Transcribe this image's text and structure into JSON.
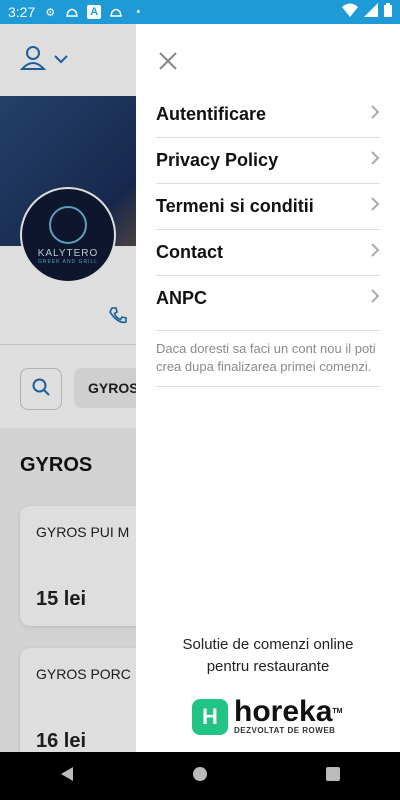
{
  "status_bar": {
    "time": "3:27",
    "icons_left": [
      "settings-icon",
      "notification-icon",
      "a-icon",
      "notification-icon",
      "dot-icon"
    ],
    "icons_right": [
      "wifi-icon",
      "signal-icon",
      "battery-icon"
    ]
  },
  "background": {
    "restaurant_logo_name": "KALYTERO",
    "restaurant_logo_sub": "GREEK AND GRILL",
    "category_chip": "GYROS",
    "section_title": "GYROS",
    "products": [
      {
        "name": "GYROS PUI M",
        "price": "15 lei"
      },
      {
        "name": "GYROS PORC",
        "price": "16 lei"
      }
    ]
  },
  "drawer": {
    "menu": [
      {
        "label": "Autentificare"
      },
      {
        "label": "Privacy Policy"
      },
      {
        "label": "Termeni si conditii"
      },
      {
        "label": "Contact"
      },
      {
        "label": "ANPC"
      }
    ],
    "note": "Daca doresti sa faci un cont nou il poti crea dupa finalizarea primei comenzi.",
    "footer_line1": "Solutie de comenzi online",
    "footer_line2": "pentru restaurante",
    "brand_name": "horeka",
    "brand_tm": "TM",
    "brand_sub": "DEZVOLTAT DE ROWEB"
  },
  "colors": {
    "status_bar": "#1e9bd6",
    "brand_green": "#22c483",
    "accent_blue": "#1e6fb5"
  }
}
